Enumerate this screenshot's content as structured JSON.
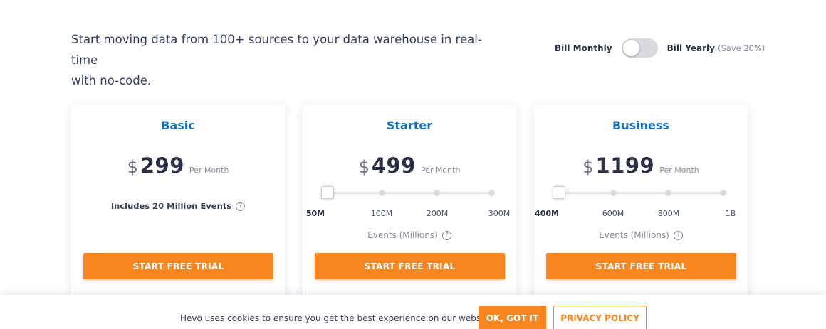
{
  "intro": {
    "line1": "Start moving data from 100+ sources to your data warehouse in real-time",
    "line2": "with no-code."
  },
  "billing": {
    "monthly_label": "Bill Monthly",
    "yearly_label": "Bill Yearly",
    "save_note": "(Save 20%)",
    "yearly_selected": false
  },
  "plans": [
    {
      "name": "Basic",
      "currency": "$",
      "price": "299",
      "period": "Per Month",
      "includes": "Includes 20 Million Events",
      "help_icon": "?",
      "cta": "START FREE TRIAL"
    },
    {
      "name": "Starter",
      "currency": "$",
      "price": "499",
      "period": "Per Month",
      "slider": {
        "selected_index": 0,
        "ticks": [
          "50M",
          "100M",
          "200M",
          "300M"
        ]
      },
      "events_label": "Events (Millions)",
      "help_icon": "?",
      "cta": "START FREE TRIAL"
    },
    {
      "name": "Business",
      "currency": "$",
      "price": "1199",
      "period": "Per Month",
      "slider": {
        "selected_index": 0,
        "ticks": [
          "400M",
          "600M",
          "800M",
          "1B"
        ]
      },
      "events_label": "Events (Millions)",
      "help_icon": "?",
      "cta": "START FREE TRIAL"
    }
  ],
  "cookie": {
    "message": "Hevo uses cookies to ensure you get the best experience on our website.",
    "ok_label": "OK, GOT IT",
    "privacy_label": "PRIVACY POLICY"
  },
  "colors": {
    "accent": "#fa861f",
    "plan_title": "#1a73c2"
  }
}
